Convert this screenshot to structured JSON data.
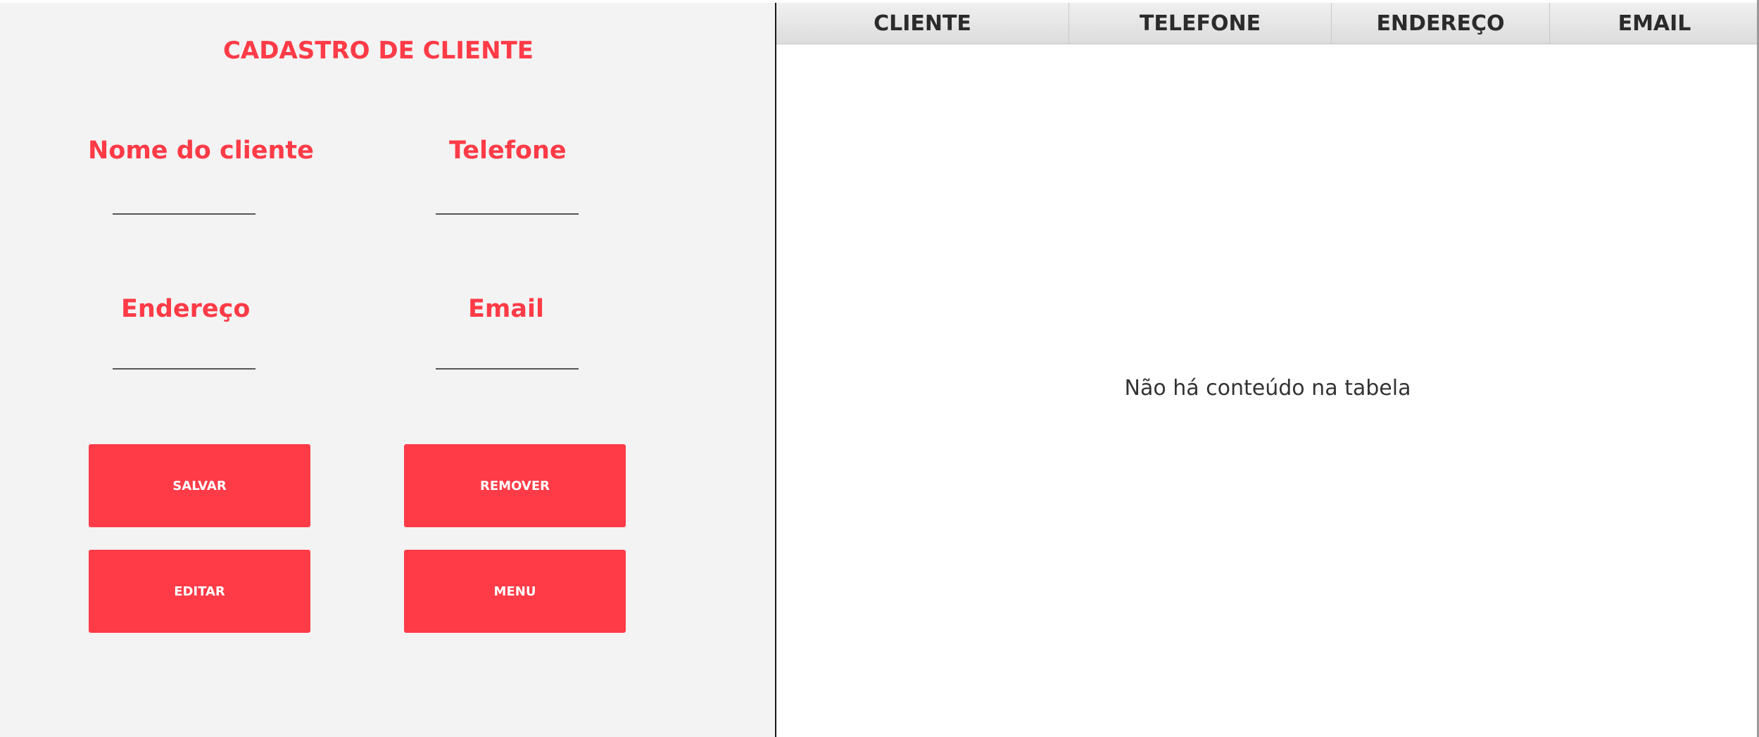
{
  "form": {
    "title": "CADASTRO DE CLIENTE",
    "fields": {
      "nome": {
        "label": "Nome do cliente",
        "value": ""
      },
      "telefone": {
        "label": "Telefone",
        "value": ""
      },
      "endereco": {
        "label": "Endereço",
        "value": ""
      },
      "email": {
        "label": "Email",
        "value": ""
      }
    },
    "buttons": {
      "salvar": "SALVAR",
      "remover": "REMOVER",
      "editar": "EDITAR",
      "menu": "MENU"
    }
  },
  "table": {
    "columns": [
      "CLIENTE",
      "TELEFONE",
      "ENDEREÇO",
      "EMAIL"
    ],
    "rows": [],
    "empty_message": "Não há conteúdo na tabela"
  },
  "colors": {
    "accent": "#ff3b47",
    "form_background": "#f3f3f3",
    "table_background": "#ffffff"
  }
}
